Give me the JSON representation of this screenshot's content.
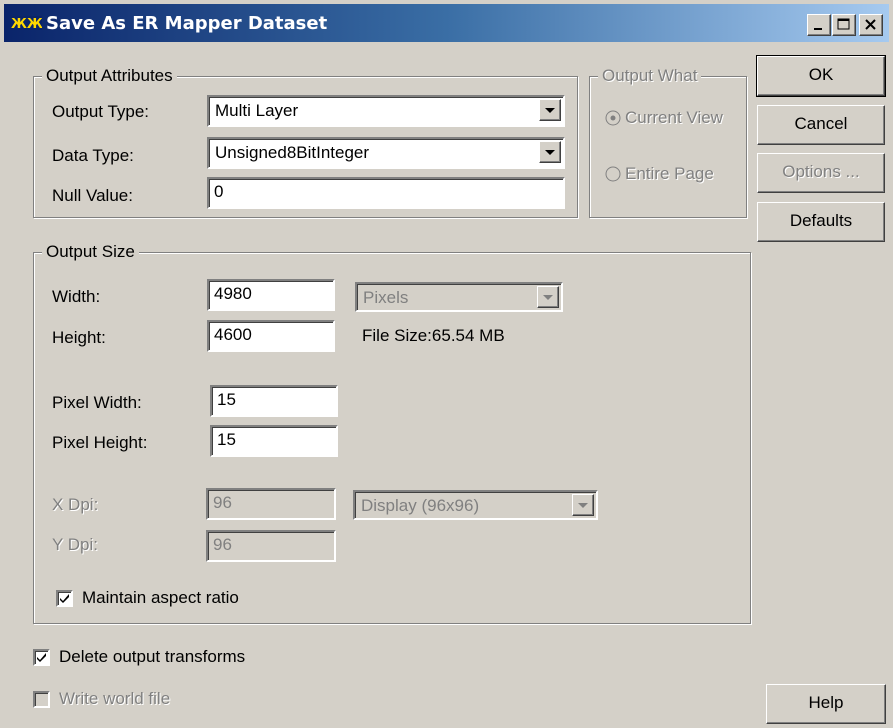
{
  "window": {
    "title": "Save As ER Mapper Dataset"
  },
  "output_attributes": {
    "group_label": "Output Attributes",
    "output_type_label": "Output Type:",
    "output_type_value": "Multi Layer",
    "data_type_label": "Data Type:",
    "data_type_value": "Unsigned8BitInteger",
    "null_value_label": "Null Value:",
    "null_value_value": "0"
  },
  "output_what": {
    "group_label": "Output What",
    "current_view_label": "Current View",
    "entire_page_label": "Entire Page",
    "selected": "Current View"
  },
  "buttons": {
    "ok": "OK",
    "cancel": "Cancel",
    "options": "Options ...",
    "defaults": "Defaults",
    "help": "Help"
  },
  "output_size": {
    "group_label": "Output Size",
    "width_label": "Width:",
    "width_value": "4980",
    "height_label": "Height:",
    "height_value": "4600",
    "units_value": "Pixels",
    "file_size_text": "File Size:65.54 MB",
    "pixel_width_label": "Pixel Width:",
    "pixel_width_value": "15",
    "pixel_height_label": "Pixel Height:",
    "pixel_height_value": "15",
    "x_dpi_label": "X Dpi:",
    "x_dpi_value": "96",
    "y_dpi_label": "Y Dpi:",
    "y_dpi_value": "96",
    "dpi_mode_value": "Display (96x96)",
    "maintain_aspect_label": "Maintain aspect ratio",
    "maintain_aspect_checked": true
  },
  "options": {
    "delete_transforms_label": "Delete output transforms",
    "delete_transforms_checked": true,
    "write_world_file_label": "Write world file",
    "write_world_file_checked": false
  },
  "colors": {
    "titlebar_start": "#0a246a",
    "titlebar_end": "#a6caf0",
    "face": "#d4d0c8"
  }
}
